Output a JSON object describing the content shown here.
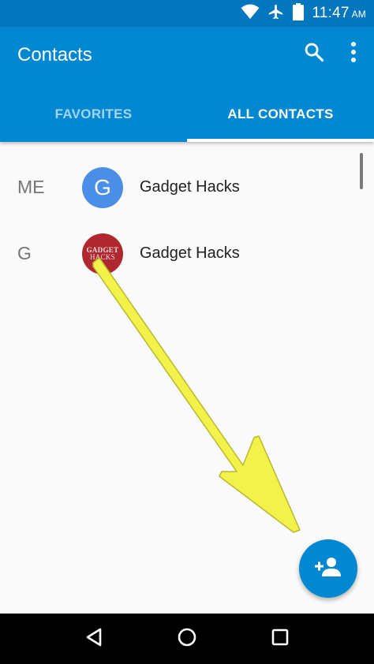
{
  "status_bar": {
    "time": "11:47",
    "ampm": "AM",
    "icons": [
      "wifi-icon",
      "airplane-mode-icon",
      "battery-icon"
    ]
  },
  "app_bar": {
    "title": "Contacts",
    "actions": [
      "search-icon",
      "more-vert-icon"
    ],
    "tabs": [
      {
        "label": "FAVORITES",
        "selected": false
      },
      {
        "label": "ALL CONTACTS",
        "selected": true
      }
    ]
  },
  "contacts": [
    {
      "section": "ME",
      "avatar_letter": "G",
      "avatar_type": "letter",
      "name": "Gadget Hacks"
    },
    {
      "section": "G",
      "avatar_type": "photo",
      "avatar_text": [
        "GADGET",
        "HACKS"
      ],
      "name": "Gadget Hacks"
    }
  ],
  "fab": {
    "icon": "add-person-icon"
  },
  "nav_bar": {
    "buttons": [
      "back-icon",
      "home-icon",
      "recents-icon"
    ]
  },
  "colors": {
    "status_bar": "#0277bd",
    "app_bar": "#0288d1",
    "accent": "#0288d1",
    "avatar_me": "#4a8ee8",
    "avatar_photo": "#b0282f",
    "annotation_arrow": "#f2f24a"
  }
}
